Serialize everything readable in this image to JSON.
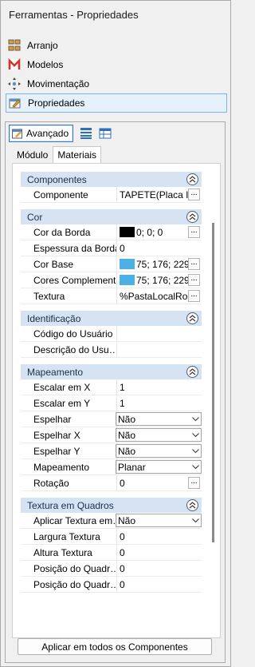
{
  "window": {
    "title": "Ferramentas - Propriedades"
  },
  "nav": {
    "items": [
      {
        "label": "Arranjo",
        "icon": "arrange-icon"
      },
      {
        "label": "Modelos",
        "icon": "models-icon"
      },
      {
        "label": "Movimentação",
        "icon": "move-icon"
      },
      {
        "label": "Propriedades",
        "icon": "properties-icon"
      }
    ]
  },
  "toolbar": {
    "advanced_label": "Avançado"
  },
  "tabs": {
    "module": "Módulo",
    "materials": "Materiais"
  },
  "sections": {
    "componentes": {
      "title": "Componentes",
      "rows": [
        {
          "label": "Componente",
          "value": "TAPETE(Placa I"
        }
      ]
    },
    "cor": {
      "title": "Cor",
      "rows": [
        {
          "label": "Cor da Borda",
          "value": "0; 0; 0",
          "color": "#000000"
        },
        {
          "label": "Espessura da Borda",
          "value": "0"
        },
        {
          "label": "Cor Base",
          "value": "75; 176; 229",
          "color": "#4bb0e5"
        },
        {
          "label": "Cores Complement…",
          "value": "75; 176; 229",
          "color": "#4bb0e5"
        },
        {
          "label": "Textura",
          "value": "%PastaLocalRoo"
        }
      ]
    },
    "identificacao": {
      "title": "Identificação",
      "rows": [
        {
          "label": "Código do Usuário",
          "value": ""
        },
        {
          "label": "Descrição do Usu…",
          "value": ""
        }
      ]
    },
    "mapeamento": {
      "title": "Mapeamento",
      "rows": [
        {
          "label": "Escalar em X",
          "value": "1"
        },
        {
          "label": "Escalar em Y",
          "value": "1"
        },
        {
          "label": "Espelhar",
          "value": "Não"
        },
        {
          "label": "Espelhar X",
          "value": "Não"
        },
        {
          "label": "Espelhar Y",
          "value": "Não"
        },
        {
          "label": "Mapeamento",
          "value": "Planar"
        },
        {
          "label": "Rotação",
          "value": "0"
        }
      ]
    },
    "textura_quadros": {
      "title": "Textura em Quadros",
      "rows": [
        {
          "label": "Aplicar Textura em…",
          "value": "Não"
        },
        {
          "label": "Largura Textura",
          "value": "0"
        },
        {
          "label": "Altura Textura",
          "value": "0"
        },
        {
          "label": "Posição do Quadr…",
          "value": "0"
        },
        {
          "label": "Posição do Quadr…",
          "value": "0"
        }
      ]
    }
  },
  "apply_button": "Aplicar em todos os Componentes"
}
